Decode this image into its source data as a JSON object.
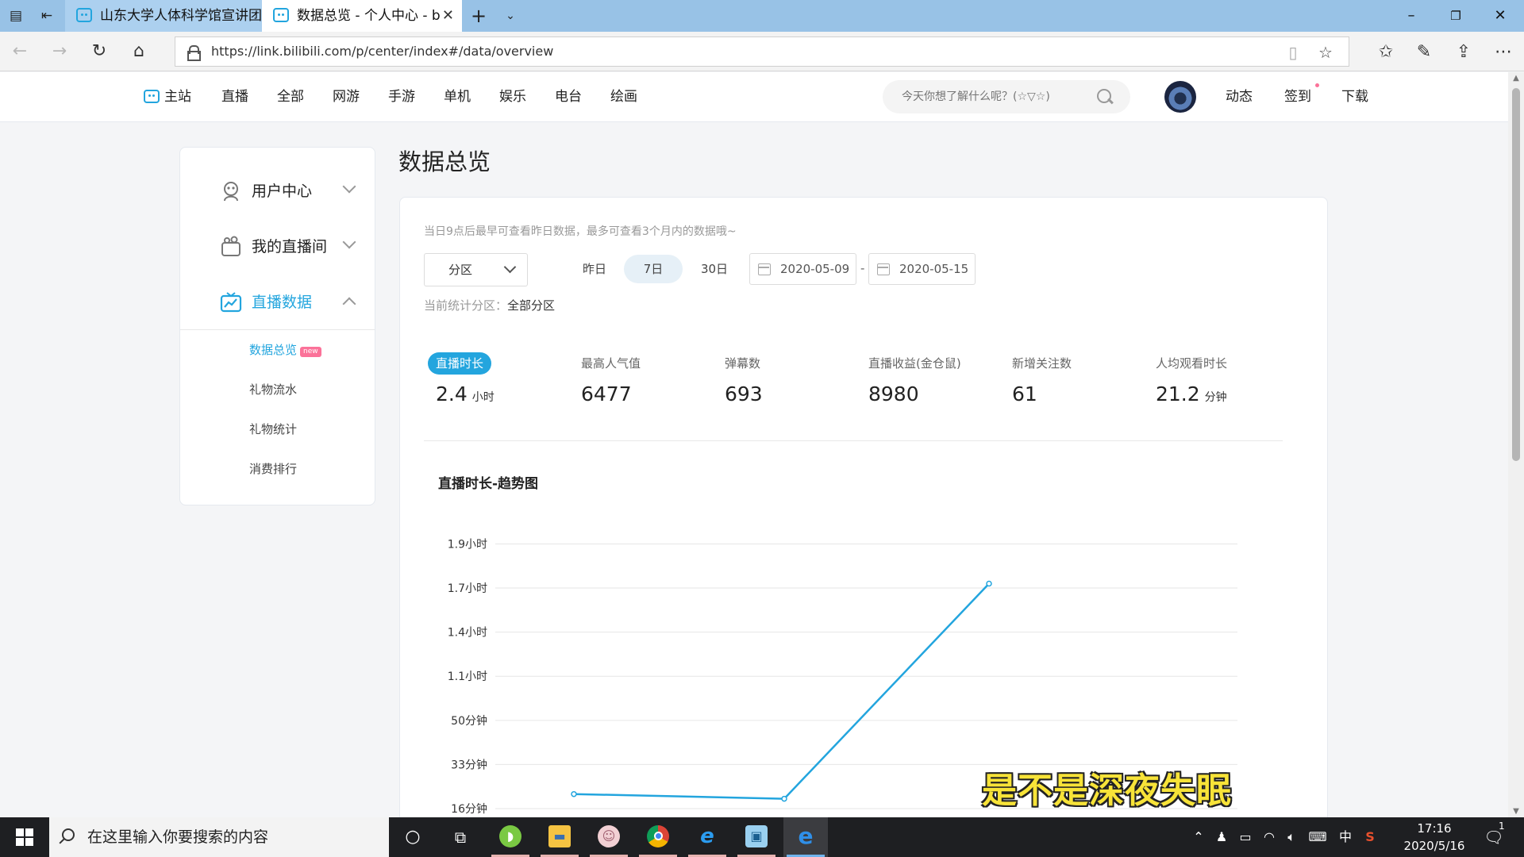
{
  "browser": {
    "tabs": [
      {
        "title": "山东大学人体科学馆宣讲团"
      },
      {
        "title": "数据总览 - 个人中心 - b"
      }
    ],
    "url": "https://link.bilibili.com/p/center/index#/data/overview"
  },
  "site_nav": {
    "home": "主站",
    "links": [
      "直播",
      "全部",
      "网游",
      "手游",
      "单机",
      "娱乐",
      "电台",
      "绘画"
    ],
    "search_placeholder": "今天你想了解什么呢？(☆▽☆)",
    "right_links": [
      "动态",
      "签到",
      "下载"
    ]
  },
  "sidebar": {
    "items": [
      {
        "label": "用户中心",
        "icon": "user-icon"
      },
      {
        "label": "我的直播间",
        "icon": "camera-icon"
      },
      {
        "label": "直播数据",
        "icon": "chart-icon"
      }
    ],
    "sub_items": [
      "数据总览",
      "礼物流水",
      "礼物统计",
      "消费排行"
    ],
    "badge": "new"
  },
  "main": {
    "title": "数据总览",
    "hint": "当日9点后最早可查看昨日数据，最多可查看3个月内的数据哦~",
    "zone_select": "分区",
    "ranges": [
      "昨日",
      "7日",
      "30日"
    ],
    "active_range": "7日",
    "date_from": "2020-05-09",
    "date_to": "2020-05-15",
    "date_sep": "-",
    "zone_current_label": "当前统计分区：",
    "zone_current_value": "全部分区",
    "stats": [
      {
        "name": "直播时长",
        "value": "2.4",
        "unit": "小时"
      },
      {
        "name": "最高人气值",
        "value": "6477",
        "unit": ""
      },
      {
        "name": "弹幕数",
        "value": "693",
        "unit": ""
      },
      {
        "name": "直播收益(金仓鼠)",
        "value": "8980",
        "unit": ""
      },
      {
        "name": "新增关注数",
        "value": "61",
        "unit": ""
      },
      {
        "name": "人均观看时长",
        "value": "21.2",
        "unit": "分钟"
      }
    ],
    "chart_title": "直播时长-趋势图"
  },
  "chart_data": {
    "type": "line",
    "title": "直播时长-趋势图",
    "y_tick_labels": [
      "16分钟",
      "33分钟",
      "50分钟",
      "1.1小时",
      "1.4小时",
      "1.7小时",
      "1.9小时"
    ],
    "series": [
      {
        "values": [
          0.36,
          0.33,
          1.72
        ]
      }
    ],
    "ylim": [
      0.27,
      1.9
    ],
    "grid": true,
    "color": "#23a5de"
  },
  "watermark": "是不是深夜失眠",
  "taskbar": {
    "search_placeholder": "在这里输入你要搜索的内容",
    "ime": "中",
    "time": "17:16",
    "date": "2020/5/16",
    "notification_count": "1"
  }
}
